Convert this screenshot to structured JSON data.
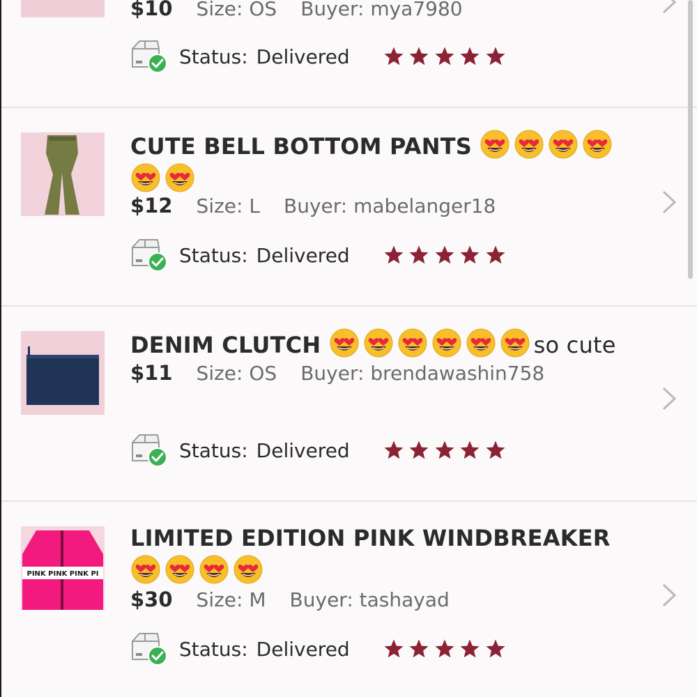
{
  "orders": [
    {
      "title": "",
      "note": "",
      "emoji_count": 0,
      "price": "$10",
      "size_label": "Size:",
      "size": "OS",
      "buyer_label": "Buyer:",
      "buyer": "mya7980",
      "status_label": "Status:",
      "status": "Delivered",
      "rating": 5,
      "image": "dark-item-thumbnail"
    },
    {
      "title": "CUTE BELL BOTTOM PANTS",
      "note": "",
      "emoji_count": 6,
      "price": "$12",
      "size_label": "Size:",
      "size": "L",
      "buyer_label": "Buyer:",
      "buyer": "mabelanger18",
      "status_label": "Status:",
      "status": "Delivered",
      "rating": 5,
      "image": "olive-pants-thumbnail"
    },
    {
      "title": "DENIM CLUTCH",
      "note": "so cute",
      "emoji_count": 6,
      "price": "$11",
      "size_label": "Size:",
      "size": "OS",
      "buyer_label": "Buyer:",
      "buyer": "brendawashin758",
      "status_label": "Status:",
      "status": "Delivered",
      "rating": 5,
      "image": "denim-clutch-thumbnail"
    },
    {
      "title": "LIMITED EDITION PINK WINDBREAKER",
      "note": "",
      "emoji_count": 4,
      "price": "$30",
      "size_label": "Size:",
      "size": "M",
      "buyer_label": "Buyer:",
      "buyer": "tashayad",
      "status_label": "Status:",
      "status": "Delivered",
      "rating": 5,
      "image": "pink-windbreaker-thumbnail",
      "thumb_text": "PINK PINK PINK PI"
    }
  ],
  "icons": {
    "emoji": "heart-eyes-emoji",
    "status": "delivered-package-icon",
    "rating": "star-icon",
    "row_action": "chevron-right-icon"
  },
  "colors": {
    "star": "#8a2334",
    "check": "#3cb054",
    "chevron": "#b9b9b9",
    "row_bg": "#fcf9fa",
    "divider": "#e3e1e2"
  }
}
